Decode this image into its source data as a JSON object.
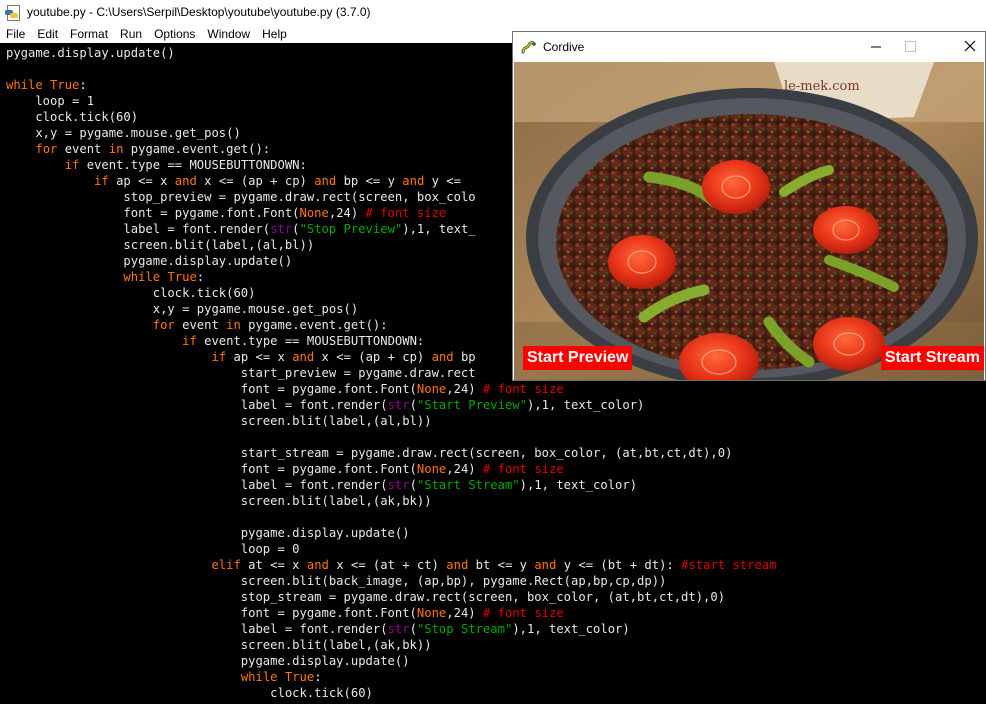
{
  "idle": {
    "title": "youtube.py - C:\\Users\\Serpil\\Desktop\\youtube\\youtube.py (3.7.0)",
    "menu": [
      "File",
      "Edit",
      "Format",
      "Run",
      "Options",
      "Window",
      "Help"
    ],
    "code": [
      [
        [
          "t",
          "pygame.display.update()"
        ]
      ],
      [],
      [
        [
          "k",
          "while"
        ],
        [
          "t",
          " "
        ],
        [
          "k",
          "True"
        ],
        [
          "t",
          ":"
        ]
      ],
      [
        [
          "t",
          "    loop = 1"
        ]
      ],
      [
        [
          "t",
          "    clock.tick(60)"
        ]
      ],
      [
        [
          "t",
          "    x,y = pygame.mouse.get_pos()"
        ]
      ],
      [
        [
          "t",
          "    "
        ],
        [
          "k",
          "for"
        ],
        [
          "t",
          " event "
        ],
        [
          "k",
          "in"
        ],
        [
          "t",
          " pygame.event.get():"
        ]
      ],
      [
        [
          "t",
          "        "
        ],
        [
          "k",
          "if"
        ],
        [
          "t",
          " event.type == MOUSEBUTTONDOWN:"
        ]
      ],
      [
        [
          "t",
          "            "
        ],
        [
          "k",
          "if"
        ],
        [
          "t",
          " ap <= x "
        ],
        [
          "k",
          "and"
        ],
        [
          "t",
          " x <= (ap + cp) "
        ],
        [
          "k",
          "and"
        ],
        [
          "t",
          " bp <= y "
        ],
        [
          "k",
          "and"
        ],
        [
          "t",
          " y <="
        ]
      ],
      [
        [
          "t",
          "                stop_preview = pygame.draw.rect(screen, box_colo"
        ]
      ],
      [
        [
          "t",
          "                font = pygame.font.Font("
        ],
        [
          "k",
          "None"
        ],
        [
          "t",
          ",24) "
        ],
        [
          "c",
          "# font size"
        ]
      ],
      [
        [
          "t",
          "                label = font.render("
        ],
        [
          "b",
          "str"
        ],
        [
          "t",
          "("
        ],
        [
          "s",
          "\"Stop Preview\""
        ],
        [
          "t",
          "),1, text_"
        ]
      ],
      [
        [
          "t",
          "                screen.blit(label,(al,bl))"
        ]
      ],
      [
        [
          "t",
          "                pygame.display.update()"
        ]
      ],
      [
        [
          "t",
          "                "
        ],
        [
          "k",
          "while"
        ],
        [
          "t",
          " "
        ],
        [
          "k",
          "True"
        ],
        [
          "t",
          ":"
        ]
      ],
      [
        [
          "t",
          "                    clock.tick(60)"
        ]
      ],
      [
        [
          "t",
          "                    x,y = pygame.mouse.get_pos()"
        ]
      ],
      [
        [
          "t",
          "                    "
        ],
        [
          "k",
          "for"
        ],
        [
          "t",
          " event "
        ],
        [
          "k",
          "in"
        ],
        [
          "t",
          " pygame.event.get():"
        ]
      ],
      [
        [
          "t",
          "                        "
        ],
        [
          "k",
          "if"
        ],
        [
          "t",
          " event.type == MOUSEBUTTONDOWN:"
        ]
      ],
      [
        [
          "t",
          "                            "
        ],
        [
          "k",
          "if"
        ],
        [
          "t",
          " ap <= x "
        ],
        [
          "k",
          "and"
        ],
        [
          "t",
          " x <= (ap + cp) "
        ],
        [
          "k",
          "and"
        ],
        [
          "t",
          " bp"
        ]
      ],
      [
        [
          "t",
          "                                start_preview = pygame.draw.rect"
        ]
      ],
      [
        [
          "t",
          "                                font = pygame.font.Font("
        ],
        [
          "k",
          "None"
        ],
        [
          "t",
          ",24) "
        ],
        [
          "c",
          "# font size"
        ]
      ],
      [
        [
          "t",
          "                                label = font.render("
        ],
        [
          "b",
          "str"
        ],
        [
          "t",
          "("
        ],
        [
          "s",
          "\"Start Preview\""
        ],
        [
          "t",
          "),1, text_color)"
        ]
      ],
      [
        [
          "t",
          "                                screen.blit(label,(al,bl))"
        ]
      ],
      [],
      [
        [
          "t",
          "                                start_stream = pygame.draw.rect(screen, box_color, (at,bt,ct,dt),0)"
        ]
      ],
      [
        [
          "t",
          "                                font = pygame.font.Font("
        ],
        [
          "k",
          "None"
        ],
        [
          "t",
          ",24) "
        ],
        [
          "c",
          "# font size"
        ]
      ],
      [
        [
          "t",
          "                                label = font.render("
        ],
        [
          "b",
          "str"
        ],
        [
          "t",
          "("
        ],
        [
          "s",
          "\"Start Stream\""
        ],
        [
          "t",
          "),1, text_color)"
        ]
      ],
      [
        [
          "t",
          "                                screen.blit(label,(ak,bk))"
        ]
      ],
      [],
      [
        [
          "t",
          "                                pygame.display.update()"
        ]
      ],
      [
        [
          "t",
          "                                loop = 0"
        ]
      ],
      [
        [
          "t",
          "                            "
        ],
        [
          "k",
          "elif"
        ],
        [
          "t",
          " at <= x "
        ],
        [
          "k",
          "and"
        ],
        [
          "t",
          " x <= (at + ct) "
        ],
        [
          "k",
          "and"
        ],
        [
          "t",
          " bt <= y "
        ],
        [
          "k",
          "and"
        ],
        [
          "t",
          " y <= (bt + dt): "
        ],
        [
          "c",
          "#start stream"
        ]
      ],
      [
        [
          "t",
          "                                screen.blit(back_image, (ap,bp), pygame.Rect(ap,bp,cp,dp))"
        ]
      ],
      [
        [
          "t",
          "                                stop_stream = pygame.draw.rect(screen, box_color, (at,bt,ct,dt),0)"
        ]
      ],
      [
        [
          "t",
          "                                font = pygame.font.Font("
        ],
        [
          "k",
          "None"
        ],
        [
          "t",
          ",24) "
        ],
        [
          "c",
          "# font size"
        ]
      ],
      [
        [
          "t",
          "                                label = font.render("
        ],
        [
          "b",
          "str"
        ],
        [
          "t",
          "("
        ],
        [
          "s",
          "\"Stop Stream\""
        ],
        [
          "t",
          "),1, text_color)"
        ]
      ],
      [
        [
          "t",
          "                                screen.blit(label,(ak,bk))"
        ]
      ],
      [
        [
          "t",
          "                                pygame.display.update()"
        ]
      ],
      [
        [
          "t",
          "                                "
        ],
        [
          "k",
          "while"
        ],
        [
          "t",
          " "
        ],
        [
          "k",
          "True"
        ],
        [
          "t",
          ":"
        ]
      ],
      [
        [
          "t",
          "                                    clock.tick(60)"
        ]
      ]
    ]
  },
  "game": {
    "title": "Cordive",
    "watermark": "le-mek.com",
    "start_preview": "Start Preview",
    "start_stream": "Start Stream",
    "colors": {
      "button_bg": "#ff0000",
      "button_text": "#ffffff"
    }
  },
  "colors": {
    "editor_bg": "#000000",
    "code_text": "#e8e8e8",
    "keyword": "#ff7700",
    "builtin": "#900090",
    "string": "#00aa00",
    "comment": "#dd0000"
  }
}
